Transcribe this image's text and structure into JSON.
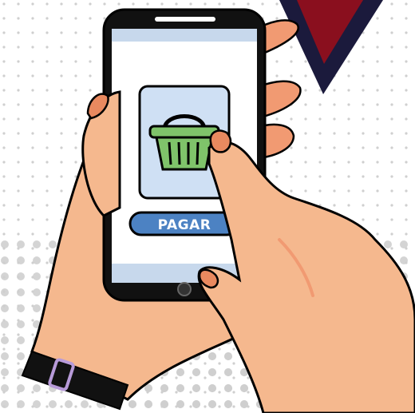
{
  "screen": {
    "pay_button_label": "PAGAR",
    "product_icon": "shopping-basket-icon"
  },
  "colors": {
    "skin": "#f5b88e",
    "skin_shadow": "#f19a72",
    "nail": "#e9895f",
    "phone_body": "#111111",
    "screen_bg": "#ffffff",
    "screen_bar": "#c7d8ec",
    "card_bg": "#cfe0f4",
    "button_bg": "#4c82c3",
    "basket": "#7fc36a",
    "triangle_outer": "#1b1a3c",
    "triangle_inner": "#8a0f1e",
    "dots": "#cfcfcf",
    "watch_buckle": "#b79ad8"
  }
}
